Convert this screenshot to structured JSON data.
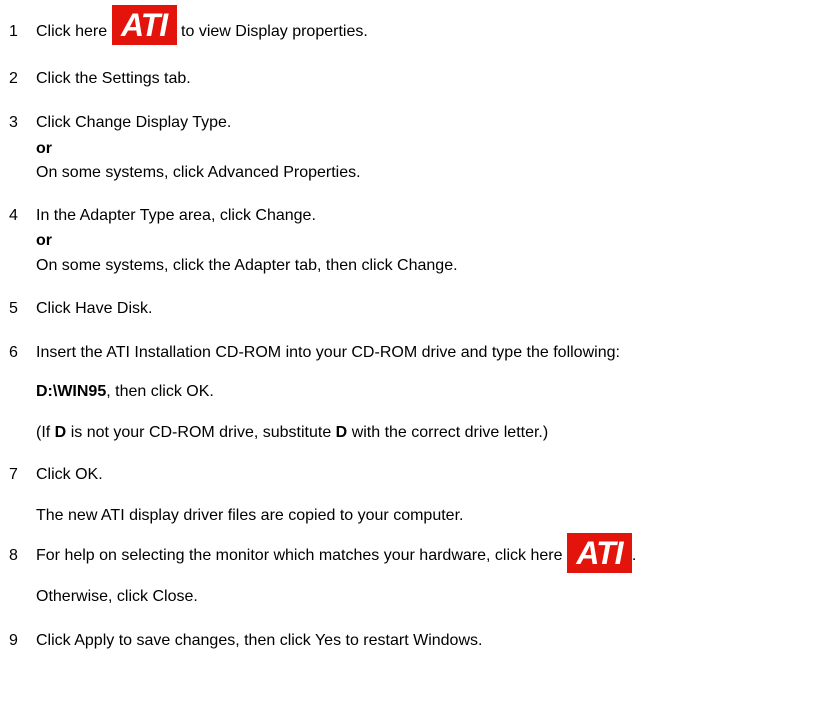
{
  "steps": [
    {
      "num": "1",
      "before": "Click here",
      "after": "to view Display properties."
    },
    {
      "num": "2",
      "text": "Click the Settings tab."
    },
    {
      "num": "3",
      "text": "Click Change Display Type.",
      "or": "or",
      "alt": "On some systems, click Advanced Properties."
    },
    {
      "num": "4",
      "text": "In the Adapter Type area, click Change.",
      "or": "or",
      "alt": "On some systems, click the Adapter tab, then click Change."
    },
    {
      "num": "5",
      "text": "Click Have Disk."
    },
    {
      "num": "6",
      "text": "Insert the ATI Installation CD-ROM into your CD-ROM drive and type the following:",
      "path_bold": "D:\\WIN95",
      "path_rest": ", then click OK.",
      "note_open": "(If",
      "note_d1": "D",
      "note_mid": "is not your CD-ROM drive, substitute",
      "note_d2": "D",
      "note_end": "with the correct drive letter.)"
    },
    {
      "num": "7",
      "text": "Click OK.",
      "sub": "The new ATI display driver files are copied to your computer."
    },
    {
      "num": "8",
      "text": "For help on selecting the monitor which matches your hardware, click here",
      "period": ".",
      "sub": "Otherwise, click Close."
    },
    {
      "num": "9",
      "text": "Click Apply to save changes, then click Yes to restart Windows."
    }
  ],
  "ati_logo": {
    "text": "ATI",
    "icon": "ati-logo-icon",
    "color": "#e3140b"
  }
}
